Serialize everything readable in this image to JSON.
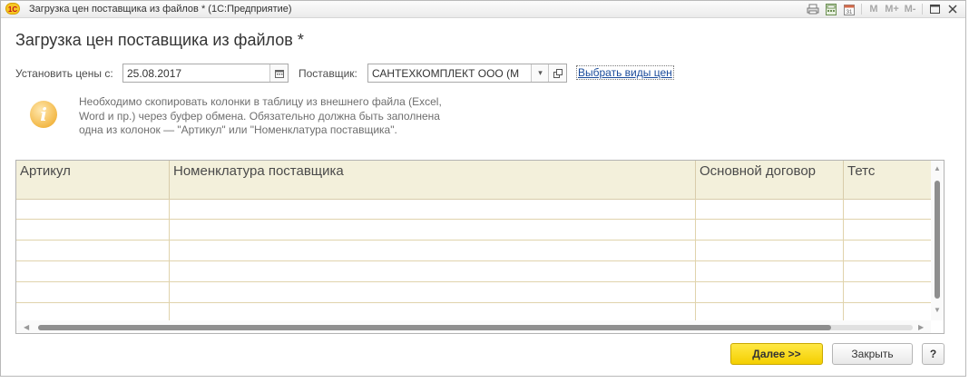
{
  "window": {
    "app_logo": "1С",
    "title": "Загрузка цен поставщика из файлов * (1С:Предприятие)",
    "toolbar_icons": [
      "printer-icon",
      "calculator-icon",
      "calendar-icon"
    ],
    "memory_buttons": [
      "M",
      "M+",
      "M-"
    ],
    "window_controls": [
      "minimize-icon",
      "maximize-icon",
      "close-icon"
    ]
  },
  "form": {
    "title": "Загрузка цен поставщика из файлов *",
    "date_label": "Установить цены с:",
    "date_value": "25.08.2017",
    "supplier_label": "Поставщик:",
    "supplier_value": "САНТЕХКОМПЛЕКТ ООО (М",
    "price_types_link": "Выбрать виды цен",
    "info_text": "Необходимо скопировать колонки в таблицу из внешнего файла (Excel, Word и пр.) через буфер обмена. Обязательно должна быть заполнена одна из колонок — \"Артикул\" или \"Номенклатура поставщика\"."
  },
  "table": {
    "columns": [
      "Артикул",
      "Номенклатура поставщика",
      "Основной договор",
      "Тетс"
    ],
    "rows": [
      [
        "",
        "",
        "",
        ""
      ],
      [
        "",
        "",
        "",
        ""
      ],
      [
        "",
        "",
        "",
        ""
      ],
      [
        "",
        "",
        "",
        ""
      ],
      [
        "",
        "",
        "",
        ""
      ],
      [
        "",
        "",
        "",
        ""
      ]
    ]
  },
  "buttons": {
    "next": "Далее >>",
    "close": "Закрыть",
    "help": "?"
  },
  "colors": {
    "header_bg": "#f3f0db",
    "primary_button": "#f4cf00",
    "link": "#1a4b9b"
  }
}
